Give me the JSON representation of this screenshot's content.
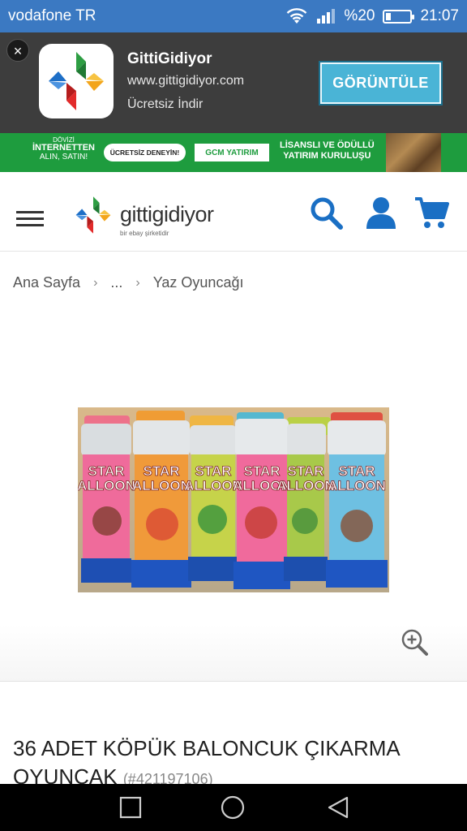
{
  "status": {
    "carrier": "vodafone TR",
    "battery": "%20",
    "time": "21:07",
    "battery_level": 0.2
  },
  "app_banner": {
    "name": "GittiGidiyor",
    "url": "www.gittigidiyor.com",
    "subtitle": "Ücretsiz İndir",
    "button": "GÖRÜNTÜLE",
    "close": "×"
  },
  "ad": {
    "left_line1": "DÖVİZİ",
    "left_line2": "İNTERNETTEN",
    "left_line3": "ALIN, SATIN!",
    "pill": "ÜCRETSİZ DENEYİN!",
    "brand": "GCM YATIRIM",
    "right_line1": "LİSANSLI VE ÖDÜLLÜ",
    "right_line2": "YATIRIM KURULUŞU"
  },
  "header": {
    "logo_text": "gittigidiyor",
    "logo_sub": "bir ebay şirketidir"
  },
  "breadcrumb": {
    "items": [
      "Ana Sayfa",
      "...",
      "Yaz Oyuncağı"
    ],
    "sep": "›"
  },
  "product": {
    "title": "36 ADET KÖPÜK BALONCUK ÇIKARMA OYUNCAK",
    "id": "(#421197106)",
    "bottle_label_line1": "STAR",
    "bottle_label_line2": "ALLOON"
  },
  "colors": {
    "status_bar": "#3b79c2",
    "banner_bg": "#3d3d3d",
    "button": "#4ab4d6",
    "ad_bg": "#1e9c3e",
    "brand_blue": "#1a6fc4"
  }
}
